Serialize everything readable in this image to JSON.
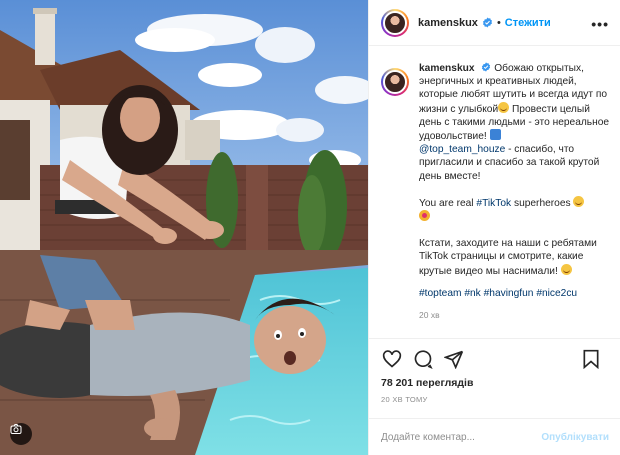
{
  "post": {
    "username": "kamenskux",
    "follow_label": "Стежити",
    "more_glyph": "•••",
    "separator": "•",
    "caption": {
      "line1": "Обожаю открытых, энергичных и креативных людей, которые любят шутить и всегда идут по жизни с улыбкой",
      "line1b": " Провести целый день с такими людьми - это нереальное удовольствие! ",
      "mention": "@top_team_houze",
      "line1c": " - спасибо, что пригласили и спасибо за такой крутой день вместе!",
      "p2_pre": "You are real ",
      "p2_tag": "#TikTok",
      "p2_post": " superheroes ",
      "p3": "Кстати, заходите на наши с ребятами TikTok страницы и смотрите, какие крутые видео мы наснимали! ",
      "tags": [
        "#topteam",
        "#nk",
        "#havingfun",
        "#nice2cu"
      ],
      "time": "20 хв"
    },
    "views": "78 201 переглядів",
    "posted_ago": "20 ХВ ТОМУ",
    "comment_placeholder": "Додайте коментар...",
    "publish_label": "Опублікувати"
  },
  "icons": {
    "verified": "verified-badge-icon",
    "like": "heart-icon",
    "comment": "comment-icon",
    "share": "paper-plane-icon",
    "save": "bookmark-icon",
    "camera": "camera-icon"
  },
  "colors": {
    "accent_blue": "#0095f6",
    "link": "#00376b",
    "muted": "#8e8e8e",
    "publish_disabled": "#b2dffc"
  }
}
